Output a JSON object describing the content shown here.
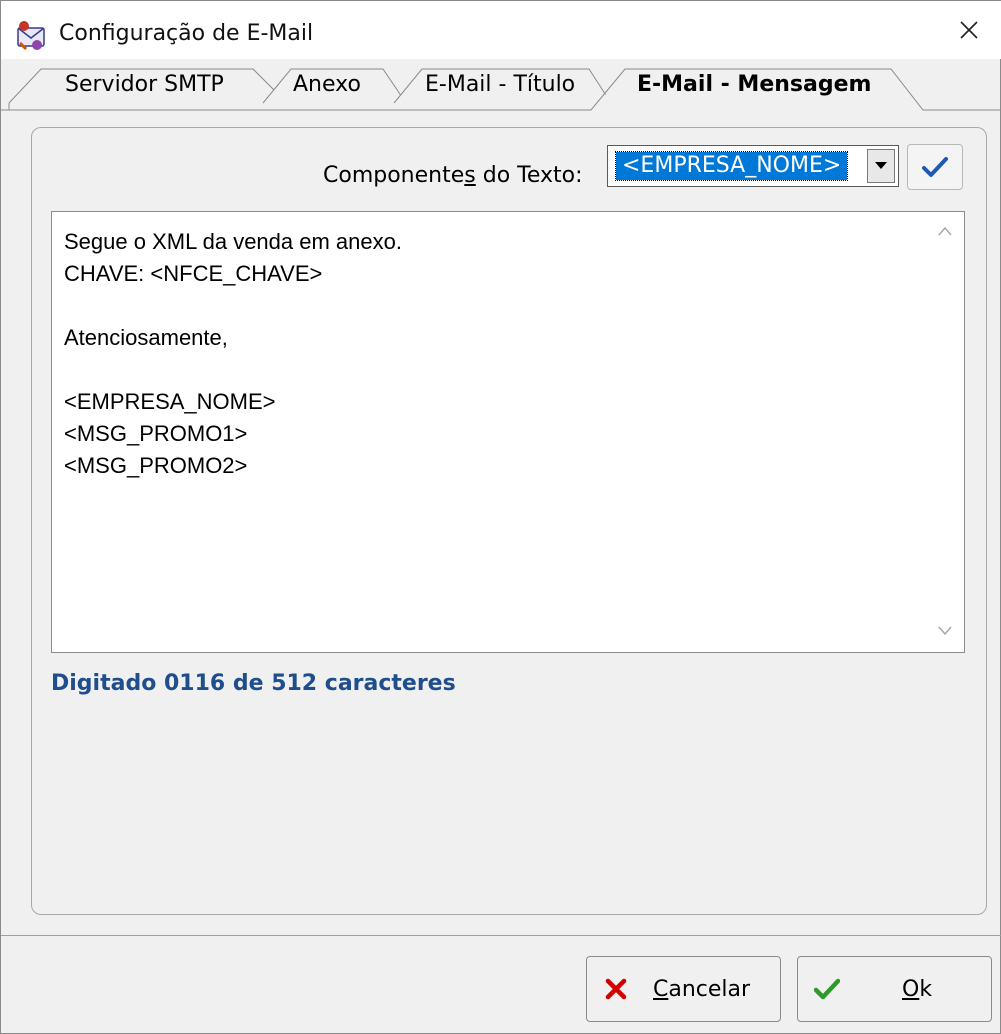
{
  "window": {
    "title": "Configuração de E-Mail"
  },
  "tabs": [
    {
      "label": "Servidor SMTP",
      "active": false
    },
    {
      "label": "Anexo",
      "active": false
    },
    {
      "label": "E-Mail - Título",
      "active": false
    },
    {
      "label": "E-Mail - Mensagem",
      "active": true
    }
  ],
  "components": {
    "label_before": "Component",
    "label_mnemonic_pre": "e",
    "label_mnemonic": "s",
    "label_after": " do Texto:",
    "selected": "<EMPRESA_NOME>"
  },
  "message": {
    "body": "Segue o XML da venda em anexo.\nCHAVE: <NFCE_CHAVE>\n\nAtenciosamente,\n\n<EMPRESA_NOME>\n<MSG_PROMO1>\n<MSG_PROMO2>"
  },
  "counter": {
    "text": "Digitado 0116 de 512 caracteres"
  },
  "buttons": {
    "cancel_mnemonic": "C",
    "cancel_rest": "ancelar",
    "ok_mnemonic": "O",
    "ok_rest": "k"
  },
  "colors": {
    "accent": "#0078d7",
    "counter_text": "#1e4e8c",
    "cancel_icon": "#d40000",
    "ok_icon": "#2e9a2e",
    "confirm_icon": "#1e5ab4"
  },
  "icons": {
    "app": "app-icon",
    "close": "close-icon",
    "dropdown": "chevron-down-icon",
    "confirm": "checkmark-icon",
    "cancel": "x-icon",
    "ok": "checkmark-icon"
  }
}
